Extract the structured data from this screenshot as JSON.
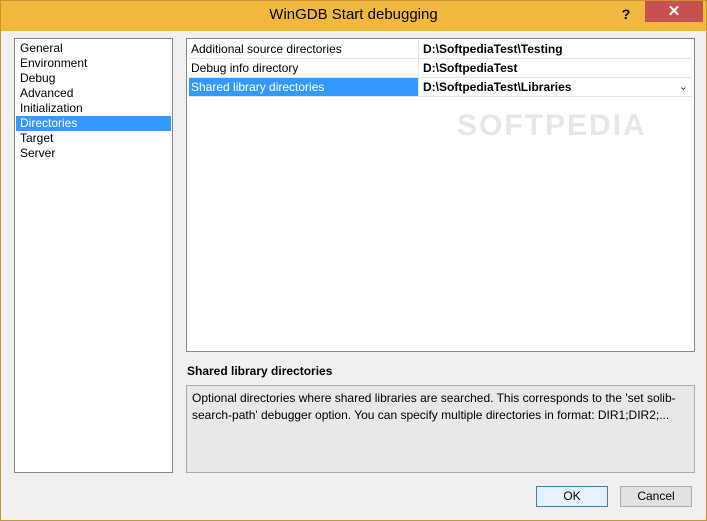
{
  "window": {
    "title": "WinGDB Start debugging",
    "help_label": "?",
    "close_label": "✕"
  },
  "categories": [
    {
      "label": "General"
    },
    {
      "label": "Environment"
    },
    {
      "label": "Debug"
    },
    {
      "label": "Advanced"
    },
    {
      "label": "Initialization"
    },
    {
      "label": "Directories",
      "selected": true
    },
    {
      "label": "Target"
    },
    {
      "label": "Server"
    }
  ],
  "properties": [
    {
      "name": "Additional source directories",
      "value": "D:\\SoftpediaTest\\Testing"
    },
    {
      "name": "Debug info directory",
      "value": "D:\\SoftpediaTest"
    },
    {
      "name": "Shared library directories",
      "value": "D:\\SoftpediaTest\\Libraries",
      "selected": true,
      "dropdown": "⌄"
    }
  ],
  "watermark": "SOFTPEDIA",
  "description": {
    "title": "Shared library directories",
    "text": "Optional directories where shared libraries are searched. This corresponds to the 'set solib-search-path' debugger option. You can specify multiple directories in format: DIR1;DIR2;..."
  },
  "buttons": {
    "ok": "OK",
    "cancel": "Cancel"
  }
}
